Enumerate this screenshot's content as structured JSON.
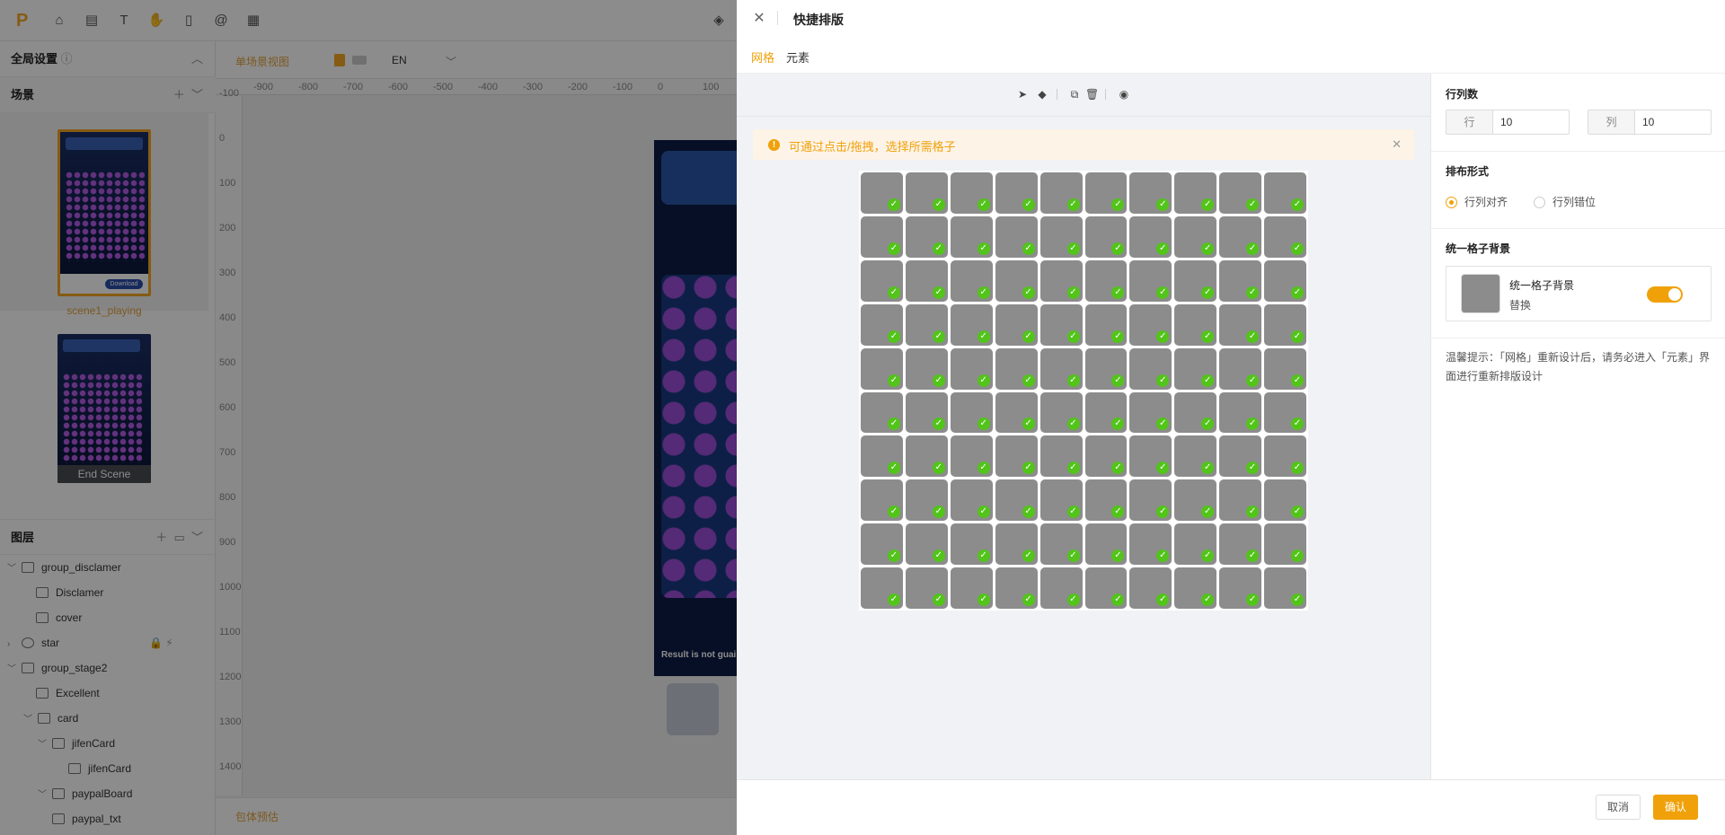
{
  "editor": {
    "toolbar": {
      "logo": "P"
    },
    "left_panel": {
      "global_settings": "全局设置",
      "scenes_title": "场景",
      "scenes": [
        {
          "name": "scene1_playing",
          "download_label": "Download"
        },
        {
          "name": "End Scene"
        }
      ],
      "layers_title": "图层",
      "layers": [
        {
          "name": "group_disclamer",
          "type": "folder",
          "expanded": true
        },
        {
          "name": "Disclamer",
          "type": "text"
        },
        {
          "name": "cover",
          "type": "image"
        },
        {
          "name": "star",
          "type": "particle",
          "expanded": false
        },
        {
          "name": "group_stage2",
          "type": "folder",
          "expanded": true
        },
        {
          "name": "Excellent",
          "type": "text"
        },
        {
          "name": "card",
          "type": "folder",
          "expanded": true
        },
        {
          "name": "jifenCard",
          "type": "folder",
          "expanded": true
        },
        {
          "name": "jifenCard",
          "type": "image"
        },
        {
          "name": "paypalBoard",
          "type": "folder",
          "expanded": true
        },
        {
          "name": "paypal_txt",
          "type": "text"
        }
      ]
    },
    "canvas": {
      "view_mode": "单场景视图",
      "language": "EN",
      "ruler_x": [
        "-900",
        "-800",
        "-700",
        "-600",
        "-500",
        "-400",
        "-300",
        "-200",
        "-100",
        "0",
        "100"
      ],
      "ruler_y": [
        "-100",
        "0",
        "100",
        "200",
        "300",
        "400",
        "500",
        "600",
        "700",
        "800",
        "900",
        "1000",
        "1100",
        "1200",
        "1300",
        "1400"
      ],
      "result_text": "Result is not guai",
      "bottom_link": "包体预估"
    }
  },
  "drawer": {
    "title": "快捷排版",
    "tabs": [
      "网格",
      "元素"
    ],
    "active_tab": "网格",
    "alert": "可通过点击/拖拽，选择所需格子",
    "grid": {
      "rows": 10,
      "cols": 10,
      "all_selected": true
    },
    "settings": {
      "rows_cols_title": "行列数",
      "rows_label": "行",
      "rows_value": "10",
      "cols_label": "列",
      "cols_value": "10",
      "layout_title": "排布形式",
      "layout_options": [
        "行列对齐",
        "行列错位"
      ],
      "layout_selected": "行列对齐",
      "uniform_bg_title": "统一格子背景",
      "uniform_bg_name": "统一格子背景",
      "replace_label": "替换",
      "uniform_bg_enabled": true,
      "tip": "温馨提示：「网格」重新设计后，请务必进入「元素」界面进行重新排版设计"
    },
    "footer": {
      "cancel": "取消",
      "confirm": "确认"
    }
  }
}
